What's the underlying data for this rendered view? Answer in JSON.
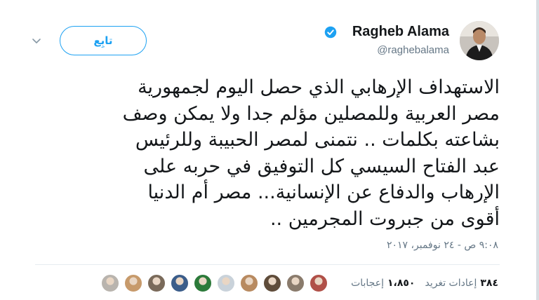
{
  "author": {
    "name": "Ragheb Alama",
    "handle": "@raghebalama",
    "verified": true
  },
  "follow_label": "تابِع",
  "tweet": {
    "lines": [
      "الاستهداف الإرهابي الذي حصل اليوم  لجمهورية",
      "مصر العربية وللمصلين مؤلم جدا ولا يمكن وصف",
      "بشاعته بكلمات .. نتمنى لمصر الحبيبة وللرئيس",
      "عبد الفتاح السيسي كل التوفيق في حربه على",
      "الإرهاب  والدفاع عن الإنسانية... مصر أم الدنيا",
      "أقوى من جبروت المجرمين  .."
    ],
    "timestamp": "٩:٠٨ ص - ٢٤ نوفمبر، ٢٠١٧"
  },
  "stats": {
    "retweets_count": "٣٨٤",
    "retweets_label": "إعادات تغريد",
    "likes_count": "١،٨٥٠",
    "likes_label": "إعجابات"
  },
  "likers": [
    {
      "name": "liker-avatar-1",
      "color": "#b9b4ae"
    },
    {
      "name": "liker-avatar-2",
      "color": "#c79a6b"
    },
    {
      "name": "liker-avatar-3",
      "color": "#7a6a5a"
    },
    {
      "name": "liker-avatar-4",
      "color": "#3b5d8a"
    },
    {
      "name": "liker-avatar-5",
      "color": "#2c7a3a"
    },
    {
      "name": "liker-avatar-6",
      "color": "#c9d2da"
    },
    {
      "name": "liker-avatar-7",
      "color": "#b88a60"
    },
    {
      "name": "liker-avatar-8",
      "color": "#5f4c3a"
    },
    {
      "name": "liker-avatar-9",
      "color": "#8a7b6c"
    },
    {
      "name": "liker-avatar-10",
      "color": "#b05048"
    }
  ],
  "colors": {
    "accent": "#1da1f2",
    "secondary_text": "#657786",
    "primary_text": "#14171a"
  }
}
